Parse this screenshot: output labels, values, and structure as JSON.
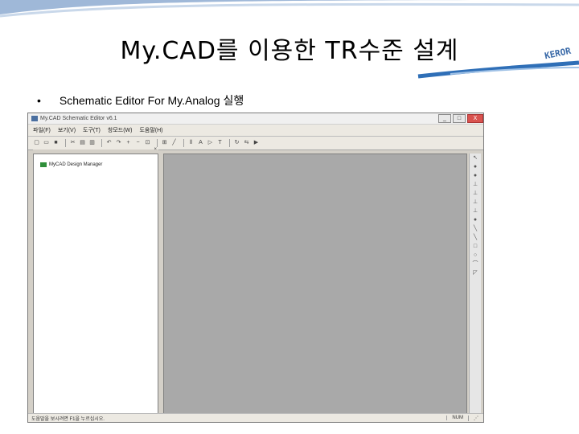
{
  "slide": {
    "title": "My.CAD를 이용한 TR수준 설계",
    "logo_text": "KEROR",
    "bullet_marker": "•",
    "bullet_text": "Schematic Editor For My.Analog 실행"
  },
  "window": {
    "title": "My.CAD Schematic Editor v6.1",
    "minimize": "_",
    "maximize": "□",
    "close": "X",
    "menu": [
      "파일(F)",
      "보기(V)",
      "도구(T)",
      "창모드(W)",
      "도움말(H)"
    ],
    "tree_item": "MyCAD Design Manager",
    "status_left": "도움말을 보시려면 F1을 누르십시오.",
    "status_right": "NUM"
  },
  "toolbar_icons": [
    "new-icon",
    "open-icon",
    "save-icon",
    "cut-icon",
    "copy-icon",
    "paste-icon",
    "undo-icon",
    "redo-icon",
    "zoom-in-icon",
    "zoom-out-icon",
    "fit-icon",
    "grid-icon",
    "wire-icon",
    "bus-icon",
    "label-icon",
    "port-icon",
    "text-icon",
    "rotate-icon",
    "flip-icon",
    "run-icon"
  ],
  "right_tool_glyphs": [
    "↖",
    "●",
    "●",
    "⊥",
    "⊥",
    "⊥",
    "⊥",
    "●",
    "╲",
    "╲",
    "□",
    "○",
    "⌒",
    "◸"
  ]
}
